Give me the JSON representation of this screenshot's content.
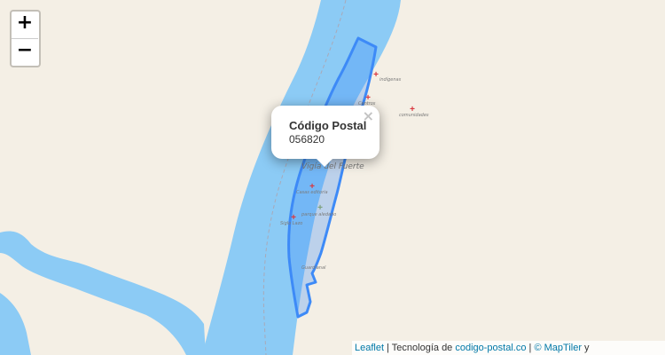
{
  "zoom": {
    "in_label": "+",
    "out_label": "−"
  },
  "popup": {
    "title": "Código Postal",
    "value": "056820",
    "close": "×"
  },
  "attribution": {
    "leaflet": "Leaflet",
    "sep1": " | Tecnología de ",
    "codigo": "codigo-postal.co",
    "sep2": " | ",
    "maptiler": "© MapTiler",
    "tail": " y"
  },
  "map_labels": {
    "town": "Vigía del Fuerte",
    "l1": "indígenas",
    "l2": "Centros",
    "l3": "comunidades",
    "l4": "Casas editoria",
    "l5": "parque aledaño",
    "l6": "Siglo Lazo",
    "l7": "Guardianal"
  },
  "colors": {
    "river": "#8ccbf5",
    "land": "#f4efe5",
    "polygon_stroke": "#3d8af7",
    "poi": "#d9363e"
  }
}
